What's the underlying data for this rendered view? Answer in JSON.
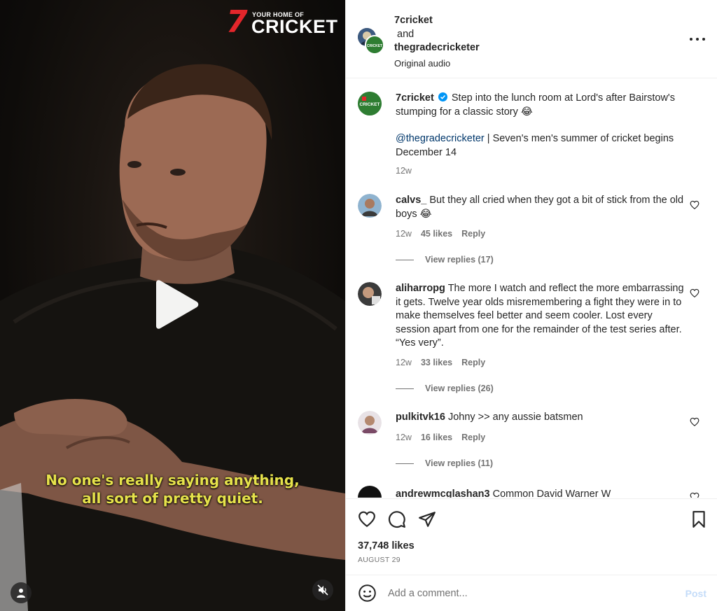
{
  "video": {
    "brand": {
      "mark": "7",
      "tagline": "YOUR HOME OF",
      "name": "CRICKET",
      "mark_color": "#e3262b"
    },
    "subtitle_line1": "No one's really saying anything,",
    "subtitle_line2": "all sort of pretty quiet.",
    "subtitle_color": "#e6e24b",
    "controls": {
      "play_icon": "play-icon",
      "user_icon": "user-icon",
      "mute_icon": "muted-speaker-icon"
    }
  },
  "header": {
    "author1": "7cricket",
    "conjunction": "and",
    "author2": "thegradecricketer",
    "audio": "Original audio",
    "more_icon": "more-horizontal-icon"
  },
  "caption": {
    "user": "7cricket",
    "verified_icon": "verified-badge-icon",
    "text": "Step into the lunch room at Lord's after Bairstow's stumping for a classic story 😂",
    "mention": "@thegradecricketer",
    "text2": " | Seven's men's summer of cricket begins December 14",
    "age": "12w"
  },
  "comments": [
    {
      "user": "calvs_",
      "text": "But they all cried when they got a bit of stick from the old boys 😂",
      "age": "12w",
      "likes": "45 likes",
      "reply": "Reply",
      "view_replies": "View replies (17)"
    },
    {
      "user": "aliharropg",
      "text": "The more I watch and reflect the more embarrassing it gets. Twelve year olds misremembering a fight they were in to make themselves feel better and seem cooler. Lost every session apart from one for the remainder of the test series after. “Yes very”.",
      "age": "12w",
      "likes": "33 likes",
      "reply": "Reply",
      "view_replies": "View replies (26)"
    },
    {
      "user": "pulkitvk16",
      "text": "Johny >> any aussie batsmen",
      "age": "12w",
      "likes": "16 likes",
      "reply": "Reply",
      "view_replies": "View replies (11)"
    },
    {
      "user": "andrewmcglashan3",
      "text": "Common David Warner W"
    }
  ],
  "actions": {
    "like_icon": "heart-icon",
    "comment_icon": "comment-icon",
    "share_icon": "share-icon",
    "save_icon": "bookmark-icon",
    "likes": "37,748 likes",
    "date": "AUGUST 29"
  },
  "composer": {
    "emoji_icon": "emoji-icon",
    "placeholder": "Add a comment...",
    "post_label": "Post"
  },
  "colors": {
    "link": "#00376b",
    "muted": "#737373",
    "verified": "#0095f6",
    "post_disabled": "#c4dcf9"
  }
}
